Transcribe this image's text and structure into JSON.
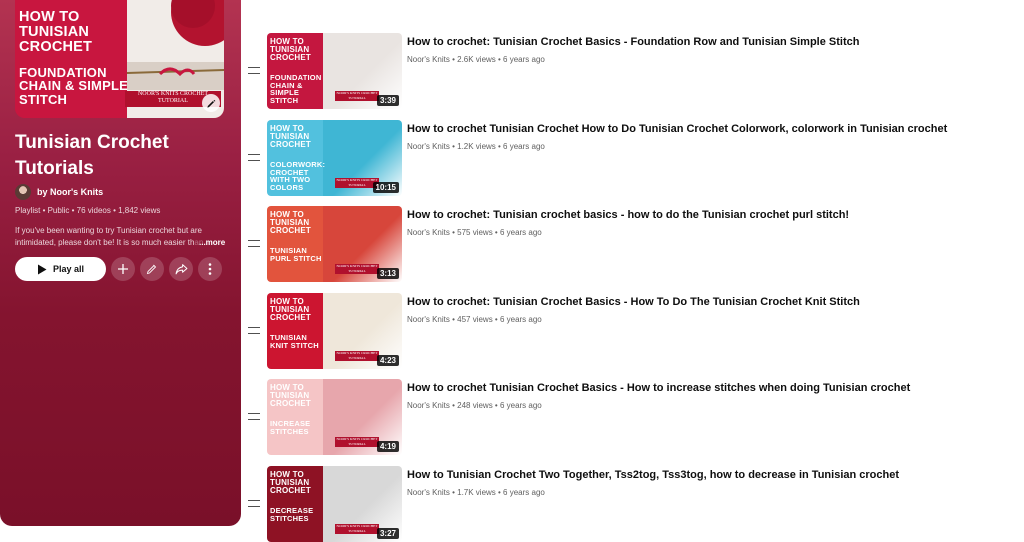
{
  "playlist": {
    "thumbnail": {
      "line1": "HOW TO TUNISIAN CROCHET",
      "line2": "FOUNDATION CHAIN & SIMPLE STITCH",
      "banner": "NOOR'S KNITS CROCHET TUTORIAL"
    },
    "title": "Tunisian Crochet Tutorials",
    "owner": "by Noor's Knits",
    "meta": "Playlist • Public • 76 videos • 1,842 views",
    "description": "If you've been wanting to try Tunisian crochet but are intimidated, please don't be! It is so much easier th",
    "description_faded": "an",
    "more_label": "...more",
    "play_all_label": "Play all",
    "accent_color": "#9a2043"
  },
  "videos": [
    {
      "title": "How to crochet: Tunisian Crochet Basics - Foundation Row and Tunisian Simple Stitch",
      "meta": "Noor's Knits • 2.6K views • 6 years ago",
      "duration": "3:39",
      "thumb_line1": "HOW TO TUNISIAN CROCHET",
      "thumb_line2": "FOUNDATION CHAIN & SIMPLE STITCH",
      "thumb_badge": "NOOR'S KNITS CROCHET TUTORIAL",
      "left_color": "#c4173f",
      "right_color": "#e9e4e1"
    },
    {
      "title": "How to crochet Tunisian Crochet How to Do Tunisian Crochet Colorwork, colorwork in Tunisian crochet",
      "meta": "Noor's Knits • 1.2K views • 6 years ago",
      "duration": "10:15",
      "thumb_line1": "HOW TO TUNISIAN CROCHET",
      "thumb_line2": "COLORWORK: CROCHET WITH TWO COLORS",
      "thumb_badge": "NOOR'S KNITS CROCHET TUTORIAL",
      "left_color": "#52c1de",
      "right_color": "#3fb6d4"
    },
    {
      "title": "How to crochet: Tunisian crochet basics - how to do the Tunisian crochet purl stitch!",
      "meta": "Noor's Knits • 575 views • 6 years ago",
      "duration": "3:13",
      "thumb_line1": "HOW TO TUNISIAN CROCHET",
      "thumb_line2": "TUNISIAN PURL STITCH",
      "thumb_badge": "NOOR'S KNITS CROCHET TUTORIAL",
      "left_color": "#e2543d",
      "right_color": "#d7463b"
    },
    {
      "title": "How to crochet: Tunisian Crochet Basics - How To Do The Tunisian Crochet Knit Stitch",
      "meta": "Noor's Knits • 457 views • 6 years ago",
      "duration": "4:23",
      "thumb_line1": "HOW TO TUNISIAN CROCHET",
      "thumb_line2": "TUNISIAN KNIT STITCH",
      "thumb_badge": "NOOR'S KNITS CROCHET TUTORIAL",
      "left_color": "#cc1530",
      "right_color": "#efe7da"
    },
    {
      "title": "How to crochet Tunisian Crochet Basics - How to increase stitches when doing Tunisian crochet",
      "meta": "Noor's Knits • 248 views • 6 years ago",
      "duration": "4:19",
      "thumb_line1": "HOW TO TUNISIAN CROCHET",
      "thumb_line2": "INCREASE STITCHES",
      "thumb_badge": "NOOR'S KNITS CROCHET TUTORIAL",
      "left_color": "#f5c5c6",
      "right_color": "#e7a6ac"
    },
    {
      "title": "How to Tunisian Crochet Two Together, Tss2tog, Tss3tog, how to decrease in Tunisian crochet",
      "meta": "Noor's Knits • 1.7K views • 6 years ago",
      "duration": "3:27",
      "thumb_line1": "HOW TO TUNISIAN CROCHET",
      "thumb_line2": "DECREASE STITCHES",
      "thumb_badge": "NOOR'S KNITS CROCHET TUTORIAL",
      "left_color": "#8e1224",
      "right_color": "#d8d8d8"
    }
  ]
}
